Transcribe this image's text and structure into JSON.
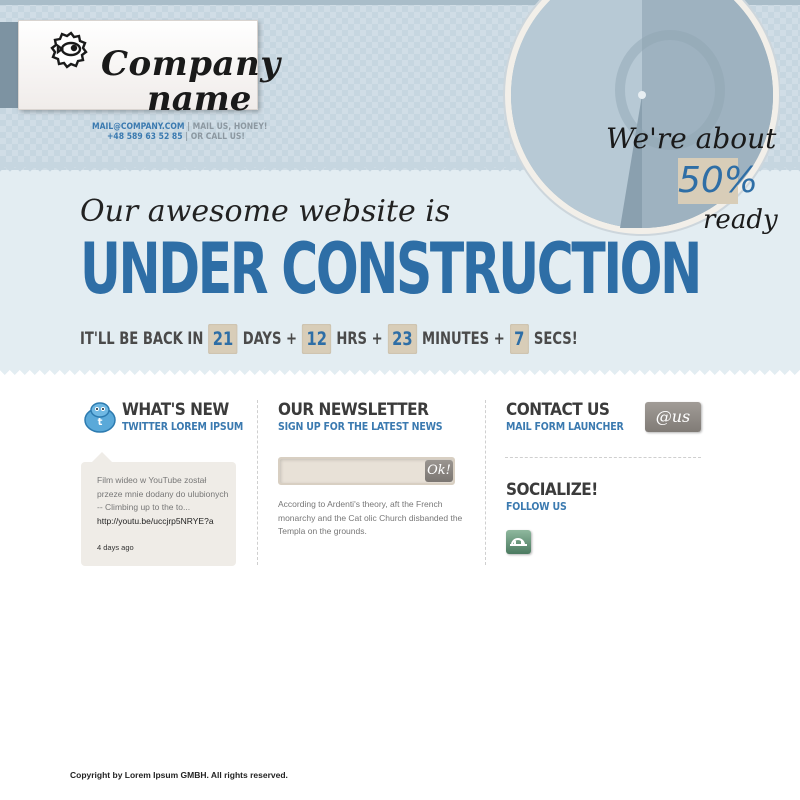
{
  "header": {
    "logo_line1": "Company",
    "logo_line2": "name",
    "email": "MAIL@COMPANY.COM",
    "email_note": "| MAIL US, HONEY!",
    "phone": "+48 589 63 52 85",
    "phone_note": "| OR CALL US!"
  },
  "progress": {
    "text_before": "We're about",
    "percent_label": "50%",
    "text_after": "ready",
    "percent_value": 50
  },
  "hero": {
    "tagline": "Our awesome website is",
    "title": "UNDER CONSTRUCTION"
  },
  "countdown": {
    "prefix": "IT'LL BE BACK IN",
    "days": "21",
    "days_label": "DAYS +",
    "hours": "12",
    "hours_label": "HRS +",
    "minutes": "23",
    "minutes_label": "MINUTES +",
    "seconds": "7",
    "seconds_label": "SECS!"
  },
  "whats_new": {
    "title": "WHAT'S NEW",
    "subtitle": "TWITTER LOREM IPSUM",
    "tweet_text": "Film wideo w YouTube został przeze mnie dodany do ulubionych -- Climbing up to the to...",
    "tweet_link": "http://youtu.be/uccjrp5NRYE?a",
    "tweet_time": "4 days ago"
  },
  "newsletter": {
    "title": "OUR NEWSLETTER",
    "subtitle": "SIGN UP FOR THE LATEST NEWS",
    "input_value": "",
    "ok_label": "Ok!",
    "description": "According to Ardenti's theory, aft the French monarchy and the Cat olic Church disbanded the Templa on the grounds."
  },
  "contact": {
    "title": "CONTACT US",
    "subtitle": "MAIL FORM LAUNCHER",
    "button_label": "@us"
  },
  "socialize": {
    "title": "SOCIALIZE!",
    "subtitle": "FOLLOW US",
    "icon": "delicious-icon"
  },
  "footer": {
    "copyright": "Copyright by Lorem Ipsum GMBH. All rights reserved."
  },
  "colors": {
    "accent_blue": "#2e6ea6",
    "header_bg": "#c6d6e0",
    "light_bg": "#e3edf2",
    "count_box": "#d8cdb8"
  }
}
